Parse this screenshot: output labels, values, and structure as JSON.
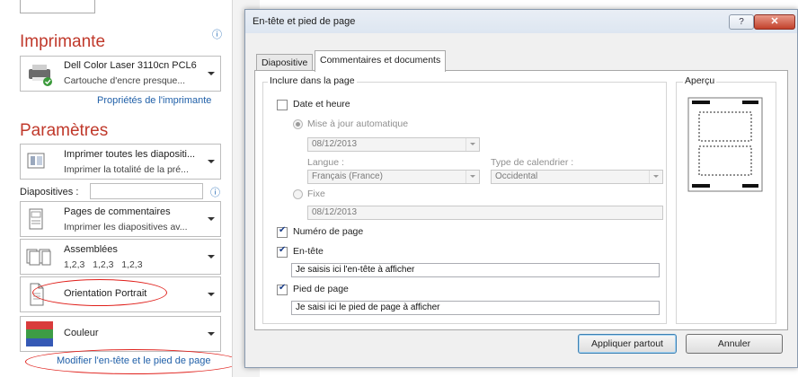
{
  "printer": {
    "section_title": "Imprimante",
    "name": "Dell Color Laser 3110cn PCL6",
    "status": "Cartouche d'encre presque...",
    "properties_link": "Propriétés de l'imprimante"
  },
  "settings": {
    "section_title": "Paramètres",
    "slides_dropdown": {
      "line1": "Imprimer toutes les diapositi...",
      "line2": "Imprimer la totalité de la pré..."
    },
    "slides_label": "Diapositives :",
    "slides_value": "",
    "layout_dropdown": {
      "line1": "Pages de commentaires",
      "line2": "Imprimer les diapositives av..."
    },
    "collate_dropdown": {
      "line1": "Assemblées",
      "line2": "1,2,3   1,2,3   1,2,3"
    },
    "orientation_dropdown": {
      "label": "Orientation Portrait"
    },
    "color_dropdown": {
      "label": "Couleur"
    },
    "header_footer_link": "Modifier l'en-tête et le pied de page",
    "colors": {
      "accent_red": "#c0392b",
      "link_blue": "#1f5fa8",
      "annotation_red": "#e0201b"
    }
  },
  "dialog": {
    "title": "En-tête et pied de page",
    "help_label": "?",
    "close_label": "✕",
    "tabs": [
      {
        "label": "Diapositive",
        "active": false
      },
      {
        "label": "Commentaires et documents",
        "active": true
      }
    ],
    "include_group_title": "Inclure dans la page",
    "date_time_label": "Date et heure",
    "date_time_checked": false,
    "auto_update_label": "Mise à jour automatique",
    "auto_update_value": "08/12/2013",
    "language_label": "Langue :",
    "language_value": "Français (France)",
    "calendar_label": "Type de calendrier :",
    "calendar_value": "Occidental",
    "fixed_label": "Fixe",
    "fixed_value": "08/12/2013",
    "page_number_label": "Numéro de page",
    "page_number_checked": true,
    "header_label": "En-tête",
    "header_checked": true,
    "header_value": "Je saisis ici l'en-tête à afficher",
    "footer_label": "Pied de page",
    "footer_checked": true,
    "footer_value": "Je saisi ici le pied de page à afficher",
    "preview_title": "Aperçu",
    "apply_all_label": "Appliquer partout",
    "cancel_label": "Annuler"
  }
}
